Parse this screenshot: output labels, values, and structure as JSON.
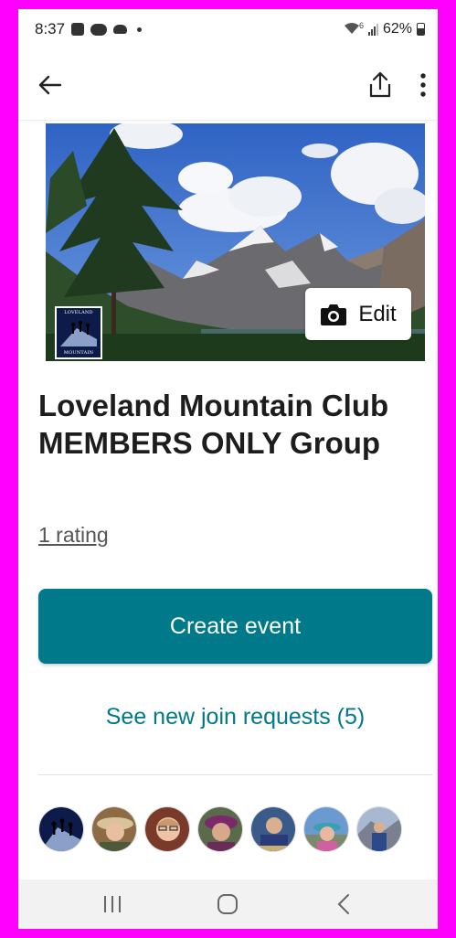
{
  "status_bar": {
    "time": "8:37",
    "network": "6",
    "battery": "62%"
  },
  "app_bar": {
    "icons": [
      "back-arrow-icon",
      "share-icon",
      "more-vert-icon"
    ]
  },
  "hero": {
    "logo_top_text": "LOVELAND",
    "logo_bottom_text": "MOUNTAIN",
    "edit_label": "Edit"
  },
  "group": {
    "title": "Loveland Mountain Club MEMBERS ONLY Group",
    "rating_text": "1 rating"
  },
  "actions": {
    "create_event_label": "Create event",
    "join_requests_label": "See new join requests (5)"
  },
  "members": [
    {
      "name": "member-avatar-club-logo"
    },
    {
      "name": "member-avatar-2"
    },
    {
      "name": "member-avatar-3"
    },
    {
      "name": "member-avatar-4"
    },
    {
      "name": "member-avatar-5"
    },
    {
      "name": "member-avatar-6"
    },
    {
      "name": "member-avatar-7"
    }
  ],
  "colors": {
    "accent": "#00798a",
    "frame": "#ff00ff"
  },
  "nav_bar": {
    "icons": [
      "recent-apps-icon",
      "home-icon",
      "back-icon"
    ]
  }
}
